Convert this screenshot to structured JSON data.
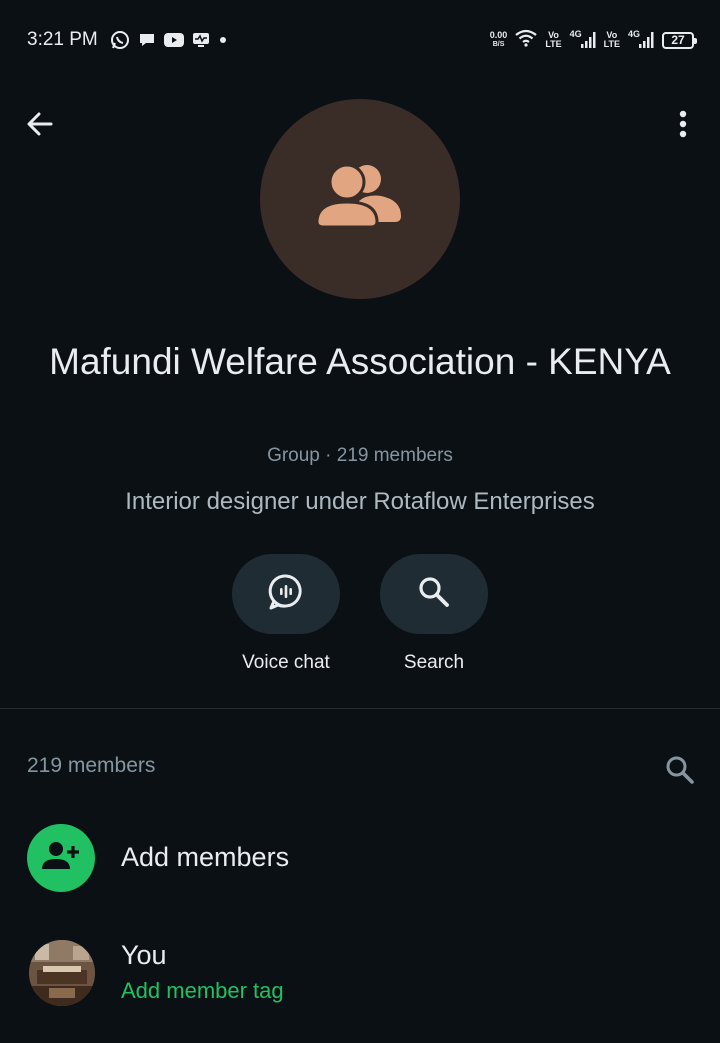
{
  "status_bar": {
    "time": "3:21 PM",
    "net_speed_value": "0.00",
    "net_speed_unit": "B/S",
    "volte_top": "Vo",
    "volte_bottom": "LTE",
    "network_type": "4G",
    "battery_level": "27",
    "notification_icons": [
      "whatsapp-icon",
      "message-icon",
      "youtube-icon",
      "activity-icon",
      "dot-icon"
    ]
  },
  "header": {
    "back_icon": "arrow-left-icon",
    "menu_icon": "more-vertical-icon"
  },
  "group": {
    "avatar_icon": "group-people-icon",
    "avatar_bg": "#3a2c27",
    "avatar_fg": "#e2a582",
    "name": "Mafundi Welfare Association - KENYA",
    "meta": "Group · 219 members",
    "description": "Interior designer under Rotaflow Enterprises"
  },
  "actions": [
    {
      "label": "Voice chat",
      "icon": "voice-chat-icon"
    },
    {
      "label": "Search",
      "icon": "search-icon"
    }
  ],
  "members": {
    "count_label": "219 members",
    "add_label": "Add members",
    "you_label": "You",
    "you_tag": "Add member tag",
    "accent": "#21c063"
  }
}
